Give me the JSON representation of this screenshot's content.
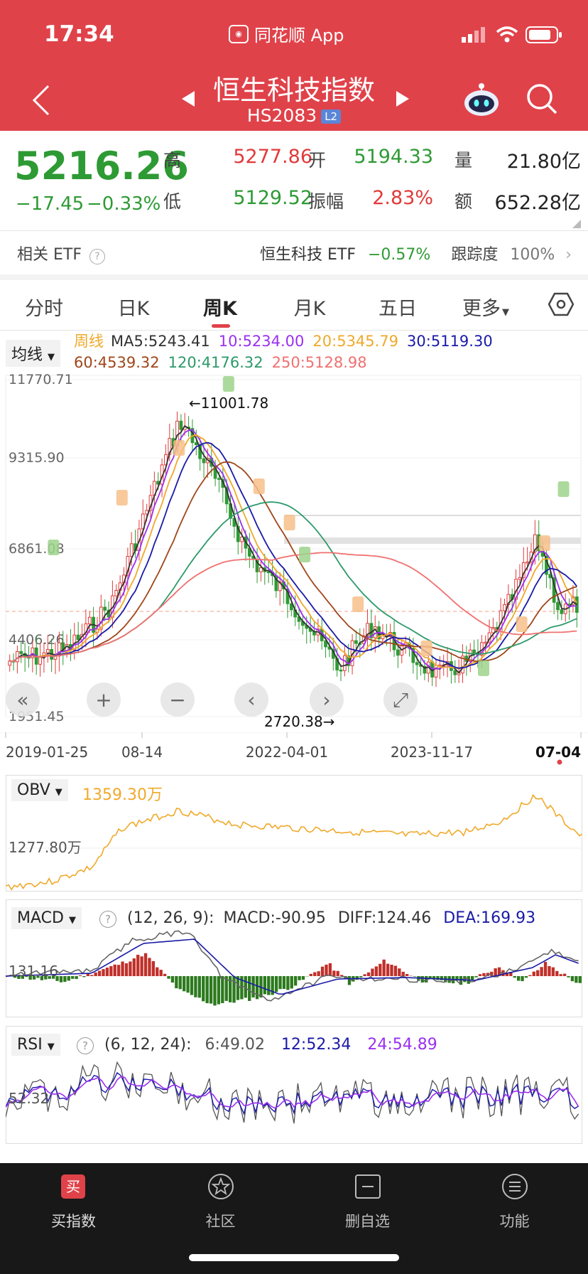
{
  "status_bar": {
    "time": "17:34",
    "app_label": "同花顺 App"
  },
  "nav": {
    "title": "恒生科技指数",
    "code": "HS2083",
    "level_badge": "L2"
  },
  "quote": {
    "price": "5216.26",
    "change": "−17.45",
    "change_pct": "−0.33%",
    "fields": [
      {
        "label": "高",
        "value": "5277.86",
        "color": "red"
      },
      {
        "label": "开",
        "value": "5194.33",
        "color": "green"
      },
      {
        "label": "量",
        "value": "21.80亿",
        "color": "blk"
      },
      {
        "label": "低",
        "value": "5129.52",
        "color": "green"
      },
      {
        "label": "振幅",
        "value": "2.83%",
        "color": "red"
      },
      {
        "label": "额",
        "value": "652.28亿",
        "color": "blk"
      }
    ]
  },
  "etf_row": {
    "label": "相关 ETF",
    "etf_name": "恒生科技 ETF",
    "etf_change": "−0.57%",
    "track_label": "跟踪度",
    "track_value": "100%"
  },
  "tabs": [
    "分时",
    "日K",
    "周K",
    "月K",
    "五日",
    "更多"
  ],
  "active_tab": "周K",
  "ma_legend": {
    "dropdown": "均线",
    "period": "周线",
    "items": [
      {
        "text": "MA5:5243.41",
        "color": "#333333"
      },
      {
        "text": "10:5234.00",
        "color": "#9b2ff0"
      },
      {
        "text": "20:5345.79",
        "color": "#f0a92a"
      },
      {
        "text": "30:5119.30",
        "color": "#1a1aa8"
      },
      {
        "text": "60:4539.32",
        "color": "#a0461a"
      },
      {
        "text": "120:4176.32",
        "color": "#2c9a6a"
      },
      {
        "text": "250:5128.98",
        "color": "#f07070"
      }
    ]
  },
  "main_chart": {
    "y_ticks": [
      "11770.71",
      "9315.90",
      "6861.08",
      "4406.26",
      "1951.45"
    ],
    "max_label": "←11001.78",
    "min_label": "2720.38→",
    "x_ticks": [
      "2019-01-25",
      "08-14",
      "2022-04-01",
      "2023-11-17",
      "07-04"
    ]
  },
  "obv": {
    "dropdown": "OBV",
    "value": "1359.30万",
    "axis_label": "1277.80万"
  },
  "macd": {
    "dropdown": "MACD",
    "params": "(12, 26, 9):",
    "macd": "MACD:-90.95",
    "diff": "DIFF:124.46",
    "dea": "DEA:169.93",
    "axis_label": "131.16"
  },
  "rsi": {
    "dropdown": "RSI",
    "params": "(6, 12, 24):",
    "r6": "6:49.02",
    "r12": "12:52.34",
    "r24": "24:54.89",
    "axis_label": "52.32"
  },
  "bottom_tabs": [
    {
      "label": "买指数",
      "icon": "buy-icon",
      "active": true
    },
    {
      "label": "社区",
      "icon": "community-icon",
      "active": false
    },
    {
      "label": "删自选",
      "icon": "remove-watchlist-icon",
      "active": false
    },
    {
      "label": "功能",
      "icon": "menu-icon",
      "active": false
    }
  ],
  "colors": {
    "header_red": "#e0424a",
    "up_red": "#e13a3a",
    "down_green": "#2e9a34",
    "obv_orange": "#f0a92a",
    "macd_blue": "#1a1aa8",
    "rsi_purple": "#9b2ff0"
  }
}
